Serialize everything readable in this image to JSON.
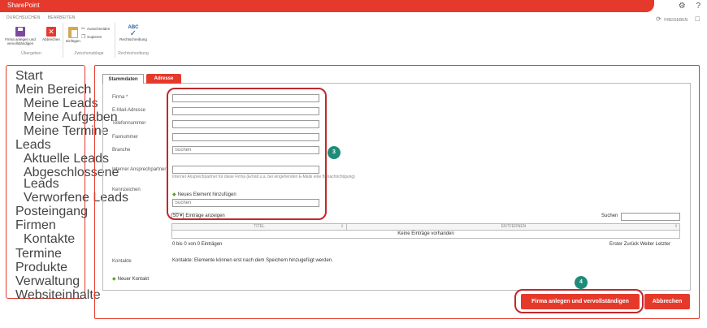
{
  "app": {
    "title": "SharePoint"
  },
  "top_icons": {
    "settings": "gear-icon",
    "help": "?"
  },
  "ribbon_tabs": [
    "DURCHSUCHEN",
    "BEARBEITEN"
  ],
  "share": {
    "label": "FREIGEBEN"
  },
  "ribbon": {
    "groups": [
      {
        "name": "Übergeben",
        "buttons": [
          "Firma anlegen und vervollständigen",
          "Abbrechen"
        ]
      },
      {
        "name": "Zwischenablage",
        "buttons": [
          "Einfügen",
          "Ausschneiden",
          "Kopieren"
        ]
      },
      {
        "name": "Rechtschreibung",
        "buttons": [
          "Rechtschreibung"
        ],
        "icon_text": "ABC"
      }
    ]
  },
  "nav": {
    "items": [
      {
        "label": "Start"
      },
      {
        "label": "Mein Bereich"
      },
      {
        "label": "Meine Leads"
      },
      {
        "label": "Meine Aufgaben"
      },
      {
        "label": "Meine Termine"
      },
      {
        "label": "Leads"
      },
      {
        "label": "Aktuelle Leads"
      },
      {
        "label": "Abgeschlossene"
      },
      {
        "label": "Leads"
      },
      {
        "label": "Verworfene Leads"
      },
      {
        "label": "Posteingang"
      },
      {
        "label": "Firmen"
      },
      {
        "label": "Kontakte"
      },
      {
        "label": "Termine"
      },
      {
        "label": "Produkte"
      },
      {
        "label": "Verwaltung"
      },
      {
        "label": "Websiteinhalte"
      }
    ]
  },
  "tabs": [
    {
      "label": "Stammdaten",
      "active": true
    },
    {
      "label": "Adresse",
      "active": false
    }
  ],
  "form": {
    "fields": [
      {
        "label": "Firma *",
        "value": ""
      },
      {
        "label": "E-Mail-Adresse",
        "value": ""
      },
      {
        "label": "Telefonnummer",
        "value": ""
      },
      {
        "label": "Faxnummer",
        "value": ""
      },
      {
        "label": "Branche",
        "placeholder": "Suchen"
      },
      {
        "label": "Interner Ansprechpartner",
        "value": ""
      }
    ],
    "ansprechpartner_hint": "Interner Ansprechpartner für diese Firma (Erhält u.a. bei eingehenden E-Mails eine Benachrichtigung)",
    "kennzeichen": {
      "label": "Kennzeichen",
      "add_new": "Neues Element hinzufügen",
      "search_placeholder": "Suchen"
    },
    "table": {
      "page_size": "50",
      "entries_label": "Einträge anzeigen",
      "search_label": "Suchen",
      "columns": [
        "TITEL",
        "ENTFERNEN"
      ],
      "empty": "Keine Einträge vorhanden",
      "info": "0 bis 0 von 0 Einträgen",
      "pager": [
        "Erster",
        "Zurück",
        "Weiter",
        "Letzter"
      ]
    },
    "kontakte": {
      "label": "Kontakte",
      "note": "Kontakte: Elemente können erst nach dem Speichern hinzugefügt werden.",
      "add_new": "Neuer Kontakt"
    }
  },
  "callouts": {
    "badge3": "3",
    "badge4": "4"
  },
  "actions": {
    "primary": "Firma anlegen und vervollständigen",
    "secondary": "Abbrechen"
  },
  "colors": {
    "accent": "#e5392b",
    "callout": "#c0282d",
    "badge": "#1f8c7a",
    "add": "#5aa02c"
  }
}
